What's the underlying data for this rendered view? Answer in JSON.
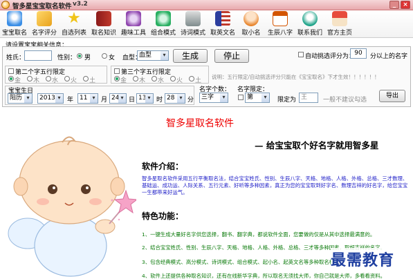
{
  "window": {
    "title": "智多星宝宝取名软件",
    "version": "v3.2",
    "minimize_label": "_",
    "close_label": "×"
  },
  "toolbar": {
    "items": [
      {
        "label": "宝宝取名",
        "icon": "baby-name-icon",
        "color": "#3a8ee6"
      },
      {
        "label": "名字评分",
        "icon": "score-icon",
        "color": "#e8a21c"
      },
      {
        "label": "自选列表",
        "icon": "star-list-icon",
        "color": "#f0c419"
      },
      {
        "label": "取名知识",
        "icon": "book-icon",
        "color": "#c0392b"
      },
      {
        "label": "趣味工具",
        "icon": "tools-icon",
        "color": "#8e44ad"
      },
      {
        "label": "组合模式",
        "icon": "combo-icon",
        "color": "#27ae60"
      },
      {
        "label": "诗词模式",
        "icon": "poem-icon",
        "color": "#7f8c8d"
      },
      {
        "label": "取英文名",
        "icon": "flag-icon",
        "color": "#2c3e9e"
      },
      {
        "label": "取小名",
        "icon": "small-name-icon",
        "color": "#e67e22"
      },
      {
        "label": "生辰八字",
        "icon": "calendar-icon",
        "color": "#d35400"
      },
      {
        "label": "联系我们",
        "icon": "contact-icon",
        "color": "#16a085"
      },
      {
        "label": "官方主页",
        "icon": "home-icon",
        "color": "#e74c3c"
      }
    ]
  },
  "form": {
    "section_label": "请设置宝宝相关信息：",
    "surname_label": "姓氏：",
    "surname_value": "",
    "gender_label": "性别：",
    "male_label": "男",
    "female_label": "女",
    "gender_selected": "男",
    "bloodtype_label": "血型：",
    "bloodtype_value": "血型",
    "generate_label": "生成",
    "stop_label": "停止",
    "auto_filter_label": "自动挑选评分为：",
    "auto_filter_value": "90",
    "auto_filter_suffix": "分以上的名字",
    "second_char_label": "第二个字五行限定",
    "third_char_label": "第三个字五行限定",
    "elements": [
      "金",
      "木",
      "水",
      "火",
      "土"
    ],
    "hint": "说明：五行限定/自动挑选评分只能在《宝宝取名》下才生效！！！！！！",
    "birthday_label": "宝宝生日",
    "calendar_value": "阳历",
    "year_value": "2013",
    "year_unit": "年",
    "month_value": "11",
    "month_unit": "月",
    "day_value": "24",
    "day_unit": "日",
    "hour_value": "13",
    "hour_unit": "时",
    "minute_value": "28",
    "minute_unit": "分",
    "name_length_label": "名字个数：",
    "name_length_value": "三字",
    "name_limit_label": "名字限定：",
    "position_value": "第",
    "limit_to_label": "限定为",
    "limit_char_value": "王",
    "limit_note": "一般不建议勾选",
    "export_label": "导出"
  },
  "content": {
    "title": "智多星取名软件",
    "slogan": "— 给宝宝取个好名字就用智多星",
    "intro_heading": "软件介绍：",
    "intro_text": "智多星取名软件采用五行平衡取名法，结合宝宝姓氏、性别、生辰八字、天格、地格、人格、外格、总格、三才数理、基础运、成功运、人际关系、五行元素、好听等多种因素，真正为您的宝宝取到好字名、数理吉祥的好名字，给您宝宝一生都带来好运气。",
    "features_heading": "特色功能：",
    "features": [
      "1、一键生成大量好名字供您选择，翻书、翻字典，都说软件全面，您要做的仅是从其中选择最满意的。",
      "2、结合宝宝姓氏、性别、生辰八字、天格、地格、人格、外格、总格、三才等多种因素，取超吉祥的名字。",
      "3、包含经典模式、高分模式、诗词模式、组合模式、起小名、起英文名等多种取名模式。",
      "4、软件上还提供各种取名知识，还有在线新华字典，所以取名无须找大师，你自己就是大师，多看看资料。"
    ],
    "watermark": "最需教育"
  }
}
